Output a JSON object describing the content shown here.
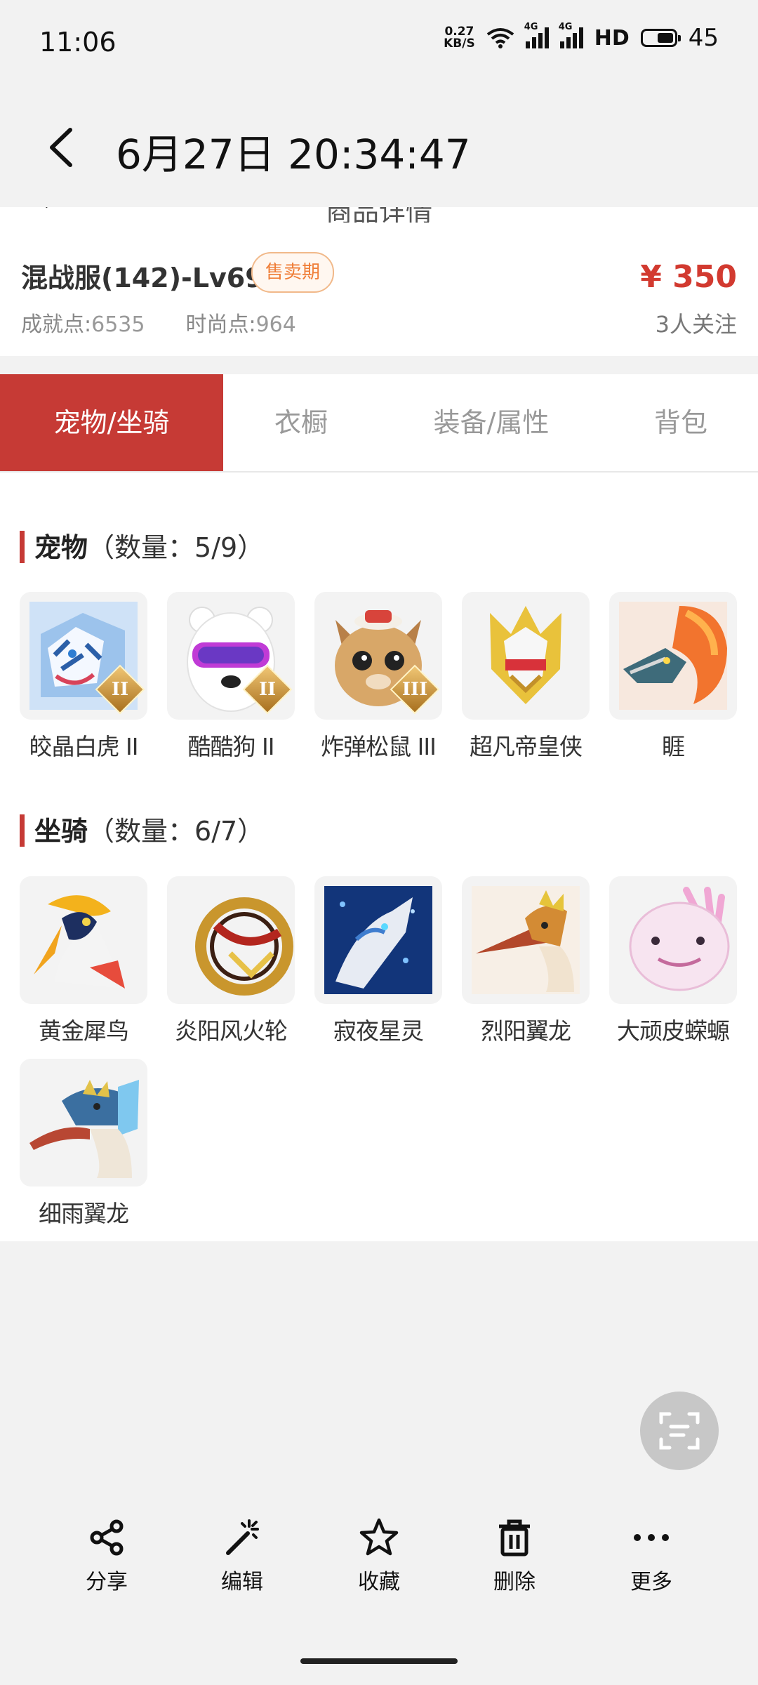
{
  "status_bar": {
    "time": "11:06",
    "speed_value": "0.27",
    "speed_unit": "KB/S",
    "net1": "4G",
    "net2": "4G",
    "hd": "HD",
    "battery": "45"
  },
  "header": {
    "title": "6月27日 20:34:47"
  },
  "page_header": {
    "title": "商品详情"
  },
  "product": {
    "name": "混战服(142)-Lv69",
    "status_badge": "售卖期",
    "price": "¥ 350",
    "achievement_label": "成就点:",
    "achievement_value": "6535",
    "fashion_label": "时尚点:",
    "fashion_value": "964",
    "followers": "3人关注"
  },
  "tabs": [
    {
      "label": "宠物/坐骑",
      "active": true
    },
    {
      "label": "衣橱",
      "active": false
    },
    {
      "label": "装备/属性",
      "active": false
    },
    {
      "label": "背包",
      "active": false
    }
  ],
  "pets": {
    "title": "宠物",
    "count": "（数量：5/9）",
    "items": [
      {
        "name": "皎晶白虎 II",
        "icon": "white-tiger",
        "grade": "II"
      },
      {
        "name": "酷酷狗 II",
        "icon": "cool-dog",
        "grade": "II"
      },
      {
        "name": "炸弹松鼠 III",
        "icon": "bomb-squirrel",
        "grade": "III"
      },
      {
        "name": "超凡帝皇侠",
        "icon": "emperor-knight"
      },
      {
        "name": "睚",
        "icon": "dragon-head"
      }
    ]
  },
  "mounts": {
    "title": "坐骑",
    "count": "（数量：6/7）",
    "items": [
      {
        "name": "黄金犀鸟",
        "icon": "golden-hornbill"
      },
      {
        "name": "炎阳风火轮",
        "icon": "fire-wheel"
      },
      {
        "name": "寂夜星灵",
        "icon": "night-spirit"
      },
      {
        "name": "烈阳翼龙",
        "icon": "sun-pterosaur"
      },
      {
        "name": "大顽皮蝾螈",
        "icon": "axolotl"
      },
      {
        "name": "细雨翼龙",
        "icon": "rain-pterosaur"
      }
    ]
  },
  "toolbar": {
    "share": "分享",
    "edit": "编辑",
    "favorite": "收藏",
    "delete": "删除",
    "more": "更多"
  },
  "colors": {
    "accent": "#c63a35",
    "price": "#d23a30",
    "badge": "#ef7d36"
  }
}
